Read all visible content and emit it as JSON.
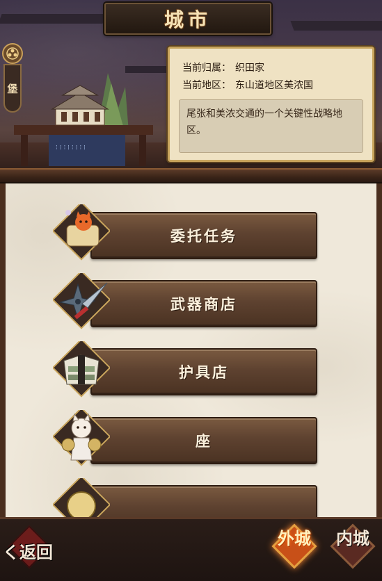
{
  "header": {
    "title": "城市"
  },
  "fortress": {
    "label": "堡"
  },
  "info": {
    "affiliation_key": "当前归属：",
    "affiliation_value": "织田家",
    "region_key": "当前地区：",
    "region_value": "东山道地区美浓国",
    "description": "尾张和美浓交通的一个关键性战略地区。"
  },
  "menu": {
    "items": [
      {
        "label": "委托任务",
        "icon": "scroll-cat-icon"
      },
      {
        "label": "武器商店",
        "icon": "kunai-shuriken-icon"
      },
      {
        "label": "护具店",
        "icon": "armor-icon"
      },
      {
        "label": "座",
        "icon": "lucky-cat-cymbals-icon"
      },
      {
        "label": "",
        "icon": "coin-icon"
      }
    ]
  },
  "footer": {
    "back_label": "返回",
    "outer_city": "外城",
    "inner_city": "内城"
  },
  "colors": {
    "button_brown": "#5e4230",
    "panel_cream": "#efe8da",
    "active_tab": "#e86a1a",
    "gold_border": "#c8a45c"
  }
}
